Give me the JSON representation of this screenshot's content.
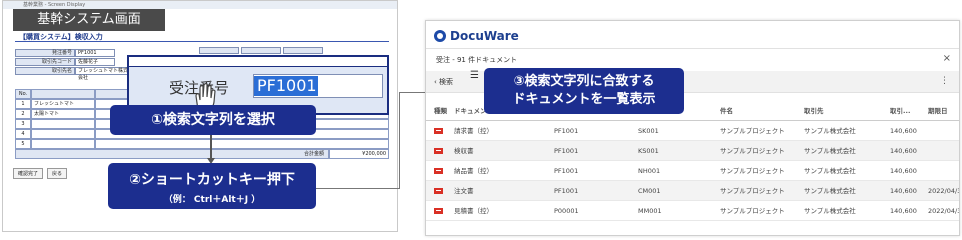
{
  "legacy": {
    "window_title": "基幹業務 - Screen Display",
    "system_label": "基幹システム画面",
    "form_title": "【購買システム】検収入力",
    "header_labels": [
      "発注番号",
      "取引先コード",
      "取引先名"
    ],
    "header_values": [
      "PF1001",
      "佐藤花子",
      "フレッシュトマト株式会社"
    ],
    "zoom_label": "受注番号",
    "zoom_value": "PF1001",
    "table_header": [
      "No.",
      "",
      ""
    ],
    "table_rows": [
      [
        "1",
        "フレッシュトマト"
      ],
      [
        "2",
        "太陽トマト"
      ],
      [
        "3",
        ""
      ],
      [
        "4",
        ""
      ],
      [
        "5",
        ""
      ]
    ],
    "total_label": "合計金額",
    "total_value": "¥200,000",
    "buttons": [
      "確認完了",
      "戻る"
    ]
  },
  "callouts": {
    "step1": "①検索文字列を選択",
    "step2": "②ショートカットキー押下",
    "step2_sub": "（例： Ctrl＋Alt＋J ）",
    "step3_line1": "③検索文字列に合致する",
    "step3_line2": "ドキュメントを一覧表示"
  },
  "docuware": {
    "brand": "DocuWare",
    "window_title": "受注 - 91 件ドキュメント",
    "close_icon": "×",
    "back_label": "‹ 検索",
    "list_icon": "☰",
    "more_icon": "⋮",
    "columns": [
      "種類",
      "ドキュメント",
      "",
      "",
      "件名",
      "取引先",
      "取引...",
      "期限日"
    ],
    "rows": [
      {
        "doc": "請求書（控）",
        "order": "PF1001",
        "code": "SK001",
        "subject": "サンプルプロジェクト",
        "partner": "サンプル株式会社",
        "amount": "140,600",
        "date": ""
      },
      {
        "doc": "検収書",
        "order": "PF1001",
        "code": "KS001",
        "subject": "サンプルプロジェクト",
        "partner": "サンプル株式会社",
        "amount": "140,600",
        "date": ""
      },
      {
        "doc": "納品書（控）",
        "order": "PF1001",
        "code": "NH001",
        "subject": "サンプルプロジェクト",
        "partner": "サンプル株式会社",
        "amount": "140,600",
        "date": ""
      },
      {
        "doc": "注文書",
        "order": "PF1001",
        "code": "CM001",
        "subject": "サンプルプロジェクト",
        "partner": "サンプル株式会社",
        "amount": "140,600",
        "date": "2022/04/3"
      },
      {
        "doc": "見積書（控）",
        "order": "P00001",
        "code": "MM001",
        "subject": "サンプルプロジェクト",
        "partner": "サンプル株式会社",
        "amount": "140,600",
        "date": "2022/04/3"
      }
    ],
    "row_icon": "pdf-icon"
  },
  "colors": {
    "callout_bg": "#1c2e8f",
    "highlight": "#2b6ed6",
    "brand": "#1d3f8f"
  }
}
